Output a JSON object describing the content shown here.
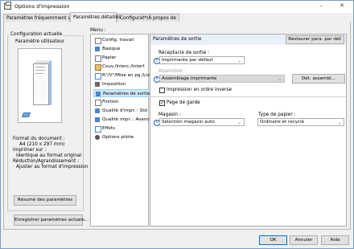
{
  "window": {
    "title": "Options d'impression",
    "controls": {
      "minimize": "–",
      "close": "✕"
    }
  },
  "tabs": [
    {
      "label": "Paramètres fréquemment utilisés"
    },
    {
      "label": "Paramètres détaillés"
    },
    {
      "label": "Configurat*/À propos de"
    }
  ],
  "left": {
    "group_title": "Configuration actuelle",
    "preview_title": "Paramètre utilisateur",
    "summary": [
      "Format du document :",
      "A4 (210 x 297 mm)",
      "Imprimer sur :",
      "Identique au format original",
      "Réduction/Agrandissement :",
      "Ajuster au format d'impression"
    ],
    "summary_button": "Résumé des paramètres",
    "save_button": "Enregistrer paramètres actuels..."
  },
  "menu": {
    "label": "Menu :",
    "items": [
      {
        "label": "Config. travail",
        "icon": "job-setup-icon"
      },
      {
        "label": "Basique",
        "icon": "basic-icon"
      },
      {
        "label": "Papier",
        "icon": "paper-icon"
      },
      {
        "label": "Couv./Interc./Interf.",
        "icon": "cover-icon"
      },
      {
        "label": "R°/V°/Mise en pg./Livret",
        "icon": "duplex-icon"
      },
      {
        "label": "Imposition",
        "icon": "imposition-icon"
      },
      {
        "label": "Paramètres de sortie",
        "icon": "output-icon"
      },
      {
        "label": "Finition",
        "icon": "finishing-icon"
      },
      {
        "label": "Qualité d'impr. : Std",
        "icon": "quality-icon"
      },
      {
        "label": "Qualité impr. : Avancée",
        "icon": "quality-advanced-icon"
      },
      {
        "label": "Effets",
        "icon": "effects-icon"
      },
      {
        "label": "Options pilote",
        "icon": "driver-options-icon"
      }
    ],
    "selected_index": 6
  },
  "panel": {
    "title": "Paramètres de sortie",
    "restore_button": "Restaurer para. par déf.",
    "output_tray_label": "Réceptacle de sortie :",
    "output_tray_value": "Imprimante par défaut",
    "collate_label": "Assembler :",
    "collate_value": "Assemblage imprimante",
    "collate_detail_button": "Dét. assembl...",
    "reverse_order_label": "Impression en ordre inverse",
    "reverse_order_checked": false,
    "cover_page_label": "Page de garde",
    "cover_page_checked": true,
    "input_tray_label": "Magasin :",
    "input_tray_value": "Sélection magasin auto",
    "paper_type_label": "Type de papier :",
    "paper_type_value": "Ordinaire et recyclé",
    "info_symbol": "i",
    "chevron": "⌄",
    "check_mark": "✓"
  },
  "footer": {
    "ok": "OK",
    "cancel": "Annuler",
    "help": "Aide"
  }
}
